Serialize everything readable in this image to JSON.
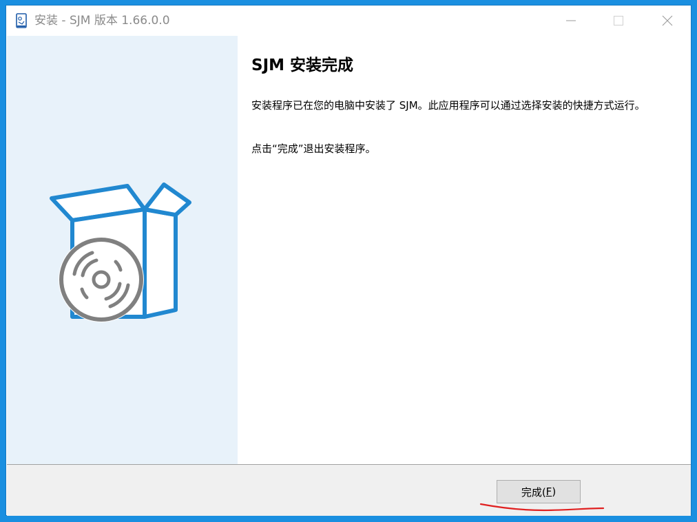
{
  "window": {
    "title": "安装 - SJM 版本 1.66.0.0",
    "icon": "installer-app-icon",
    "controls": {
      "minimize_icon": "minimize-icon",
      "maximize_icon": "maximize-icon",
      "close_icon": "close-icon"
    }
  },
  "sidebar": {
    "graphic": "software-box-with-disc-icon",
    "colors": {
      "background": "#e8f2fa",
      "box_stroke": "#2188d0",
      "disc": "#808080"
    }
  },
  "content": {
    "heading": "SJM 安装完成",
    "message": "安装程序已在您的电脑中安装了 SJM。此应用程序可以通过选择安装的快捷方式运行。",
    "finish_hint": "点击“完成”退出安装程序。"
  },
  "footer": {
    "finish_button": {
      "label_prefix": "完成(",
      "mnemonic": "F",
      "label_suffix": ")"
    }
  },
  "annotation": {
    "color": "#e02020"
  }
}
